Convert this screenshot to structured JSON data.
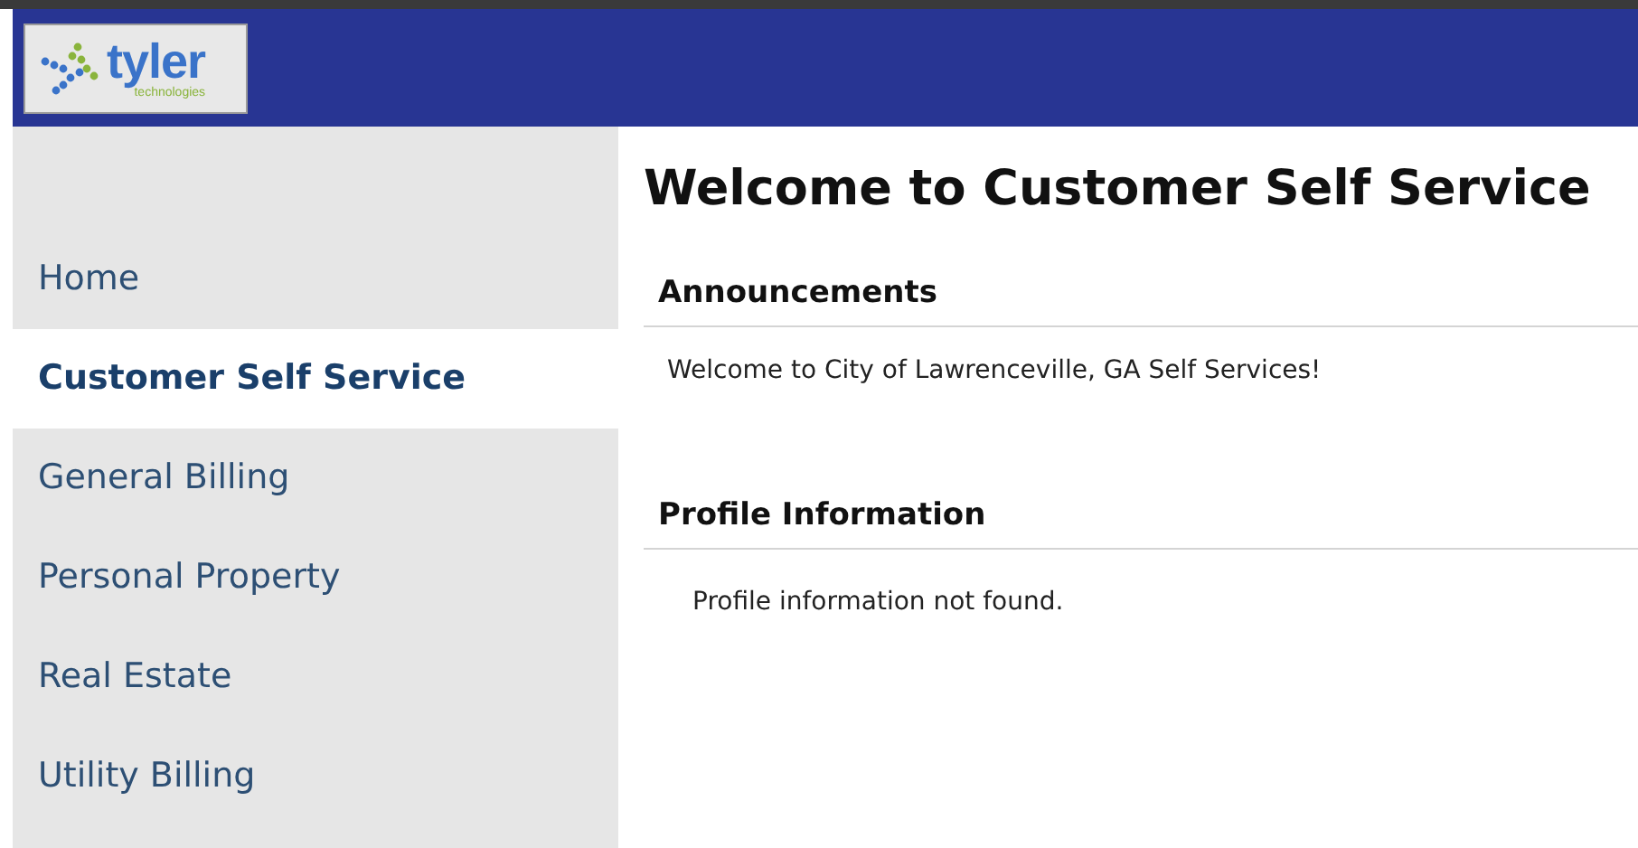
{
  "header": {
    "logo": {
      "name": "tyler",
      "tagline": "technologies"
    }
  },
  "sidebar": {
    "items": [
      {
        "label": "Home",
        "selected": false
      },
      {
        "label": "Customer Self Service",
        "selected": true
      },
      {
        "label": "General Billing",
        "selected": false
      },
      {
        "label": "Personal Property",
        "selected": false
      },
      {
        "label": "Real Estate",
        "selected": false
      },
      {
        "label": "Utility Billing",
        "selected": false
      }
    ]
  },
  "main": {
    "title": "Welcome to Customer Self Service",
    "sections": [
      {
        "heading": "Announcements",
        "text": "Welcome to City of Lawrenceville, GA Self Services!",
        "kind": "announcement"
      },
      {
        "heading": "Profile Information",
        "text": "Profile information not found.",
        "kind": "profile"
      }
    ]
  }
}
